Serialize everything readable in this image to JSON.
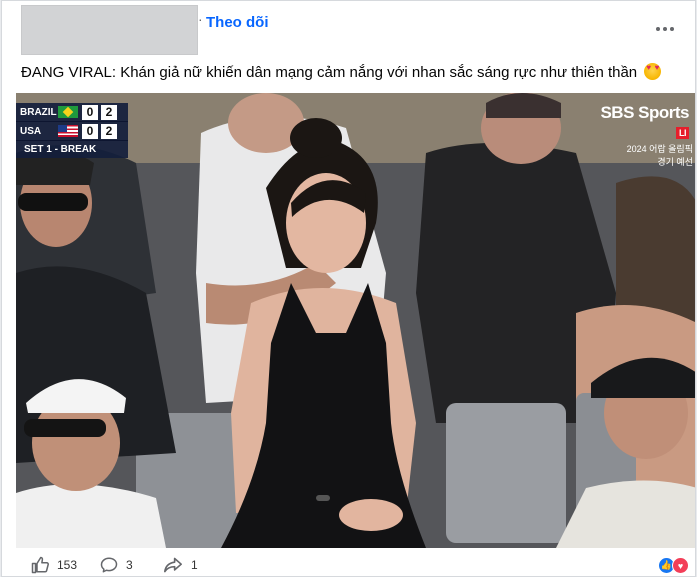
{
  "post": {
    "follow_label": "Theo dõi",
    "caption": "ĐANG VIRAL: Khán giả nữ khiến dân mạng cảm nắng với nhan sắc sáng rực như thiên thần"
  },
  "overlay": {
    "scoreboard": {
      "teams": [
        {
          "name": "BRAZIL",
          "score_a": "0",
          "score_b": "2"
        },
        {
          "name": "USA",
          "score_a": "0",
          "score_b": "2"
        }
      ],
      "status": "SET 1 - BREAK"
    },
    "broadcaster": {
      "logo": "SBS Sports",
      "live": "LI",
      "subtitle_1": "2024 어랍 올림픽",
      "subtitle_2": "경기 예선"
    }
  },
  "actions": {
    "like_count": "153",
    "comment_count": "3",
    "share_count": "1"
  },
  "icons": {
    "more": "more-dots-icon",
    "like": "thumbs-up-icon",
    "comment": "comment-bubble-icon",
    "share": "share-arrow-icon",
    "emoji": "heart-eyes-emoji-icon"
  },
  "colors": {
    "accent": "#0866ff",
    "card_bg": "#ffffff",
    "page_bg": "#e9ebee",
    "text": "#050505",
    "secondary": "#65676b"
  }
}
